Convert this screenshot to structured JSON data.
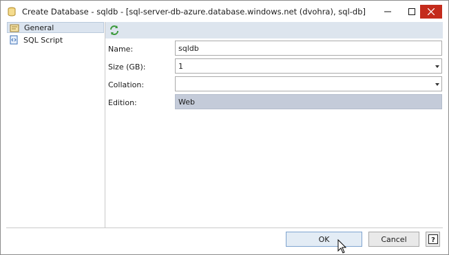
{
  "window": {
    "title": "Create Database - sqldb - [sql-server-db-azure.database.windows.net (dvohra), sql-db]",
    "icon": "database-icon",
    "controls": [
      "minimize-icon",
      "maximize-icon",
      "close-icon"
    ]
  },
  "sidebar": {
    "items": [
      {
        "label": "General",
        "icon": "general-page-icon",
        "selected": true
      },
      {
        "label": "SQL Script",
        "icon": "script-icon",
        "selected": false
      }
    ]
  },
  "toolbar": {
    "refresh_icon": "refresh-icon"
  },
  "form": {
    "name": {
      "label": "Name:",
      "value": "sqldb"
    },
    "size": {
      "label": "Size (GB):",
      "value": "1"
    },
    "collation": {
      "label": "Collation:",
      "value": ""
    },
    "edition": {
      "label": "Edition:",
      "value": "Web"
    }
  },
  "buttons": {
    "ok": "OK",
    "cancel": "Cancel",
    "help": "?"
  },
  "colors": {
    "close_button": "#c42b1c",
    "toolbar_bg": "#dde5ee",
    "readonly_bg": "#c4cbd9",
    "selected_bg": "#dbe4ef"
  }
}
